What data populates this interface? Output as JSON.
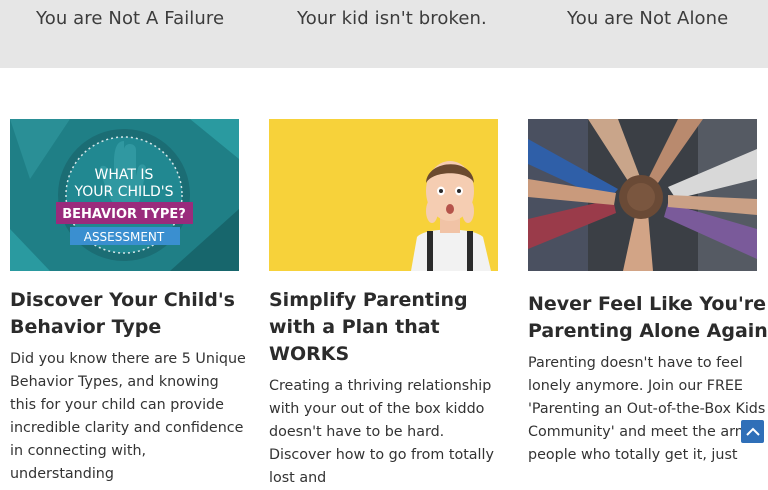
{
  "taglines": [
    "You are Not A Failure",
    "Your kid isn't broken.",
    "You are Not Alone"
  ],
  "cards": [
    {
      "title": "Discover Your Child's Behavior Type",
      "body": "Did you know there are 5 Unique Behavior Types, and knowing this for your child can provide incredible clarity and confidence in connecting with, understanding",
      "image_text": {
        "line1": "WHAT IS",
        "line2": "YOUR CHILD'S",
        "line3": "BEHAVIOR TYPE?",
        "line4": "ASSESSMENT"
      }
    },
    {
      "title": "Simplify Parenting with a Plan that WORKS",
      "body": "Creating a thriving relationship with your out of the box kiddo doesn't have to be hard. Discover how to go from totally lost and"
    },
    {
      "title": "Never Feel Like You're Parenting Alone Again",
      "body": "Parenting doesn't have to feel lonely anymore. Join our FREE 'Parenting an Out-of-the-Box Kids Community' and meet the army people who totally get it, just"
    }
  ],
  "icons": {
    "scroll_top": "chevron-up-icon"
  },
  "colors": {
    "banner": "#e6e6e6",
    "scroll_button": "#2f6fb8",
    "teal": "#1f7f86",
    "yellow": "#f7d23a",
    "magenta": "#9a2b7c"
  }
}
